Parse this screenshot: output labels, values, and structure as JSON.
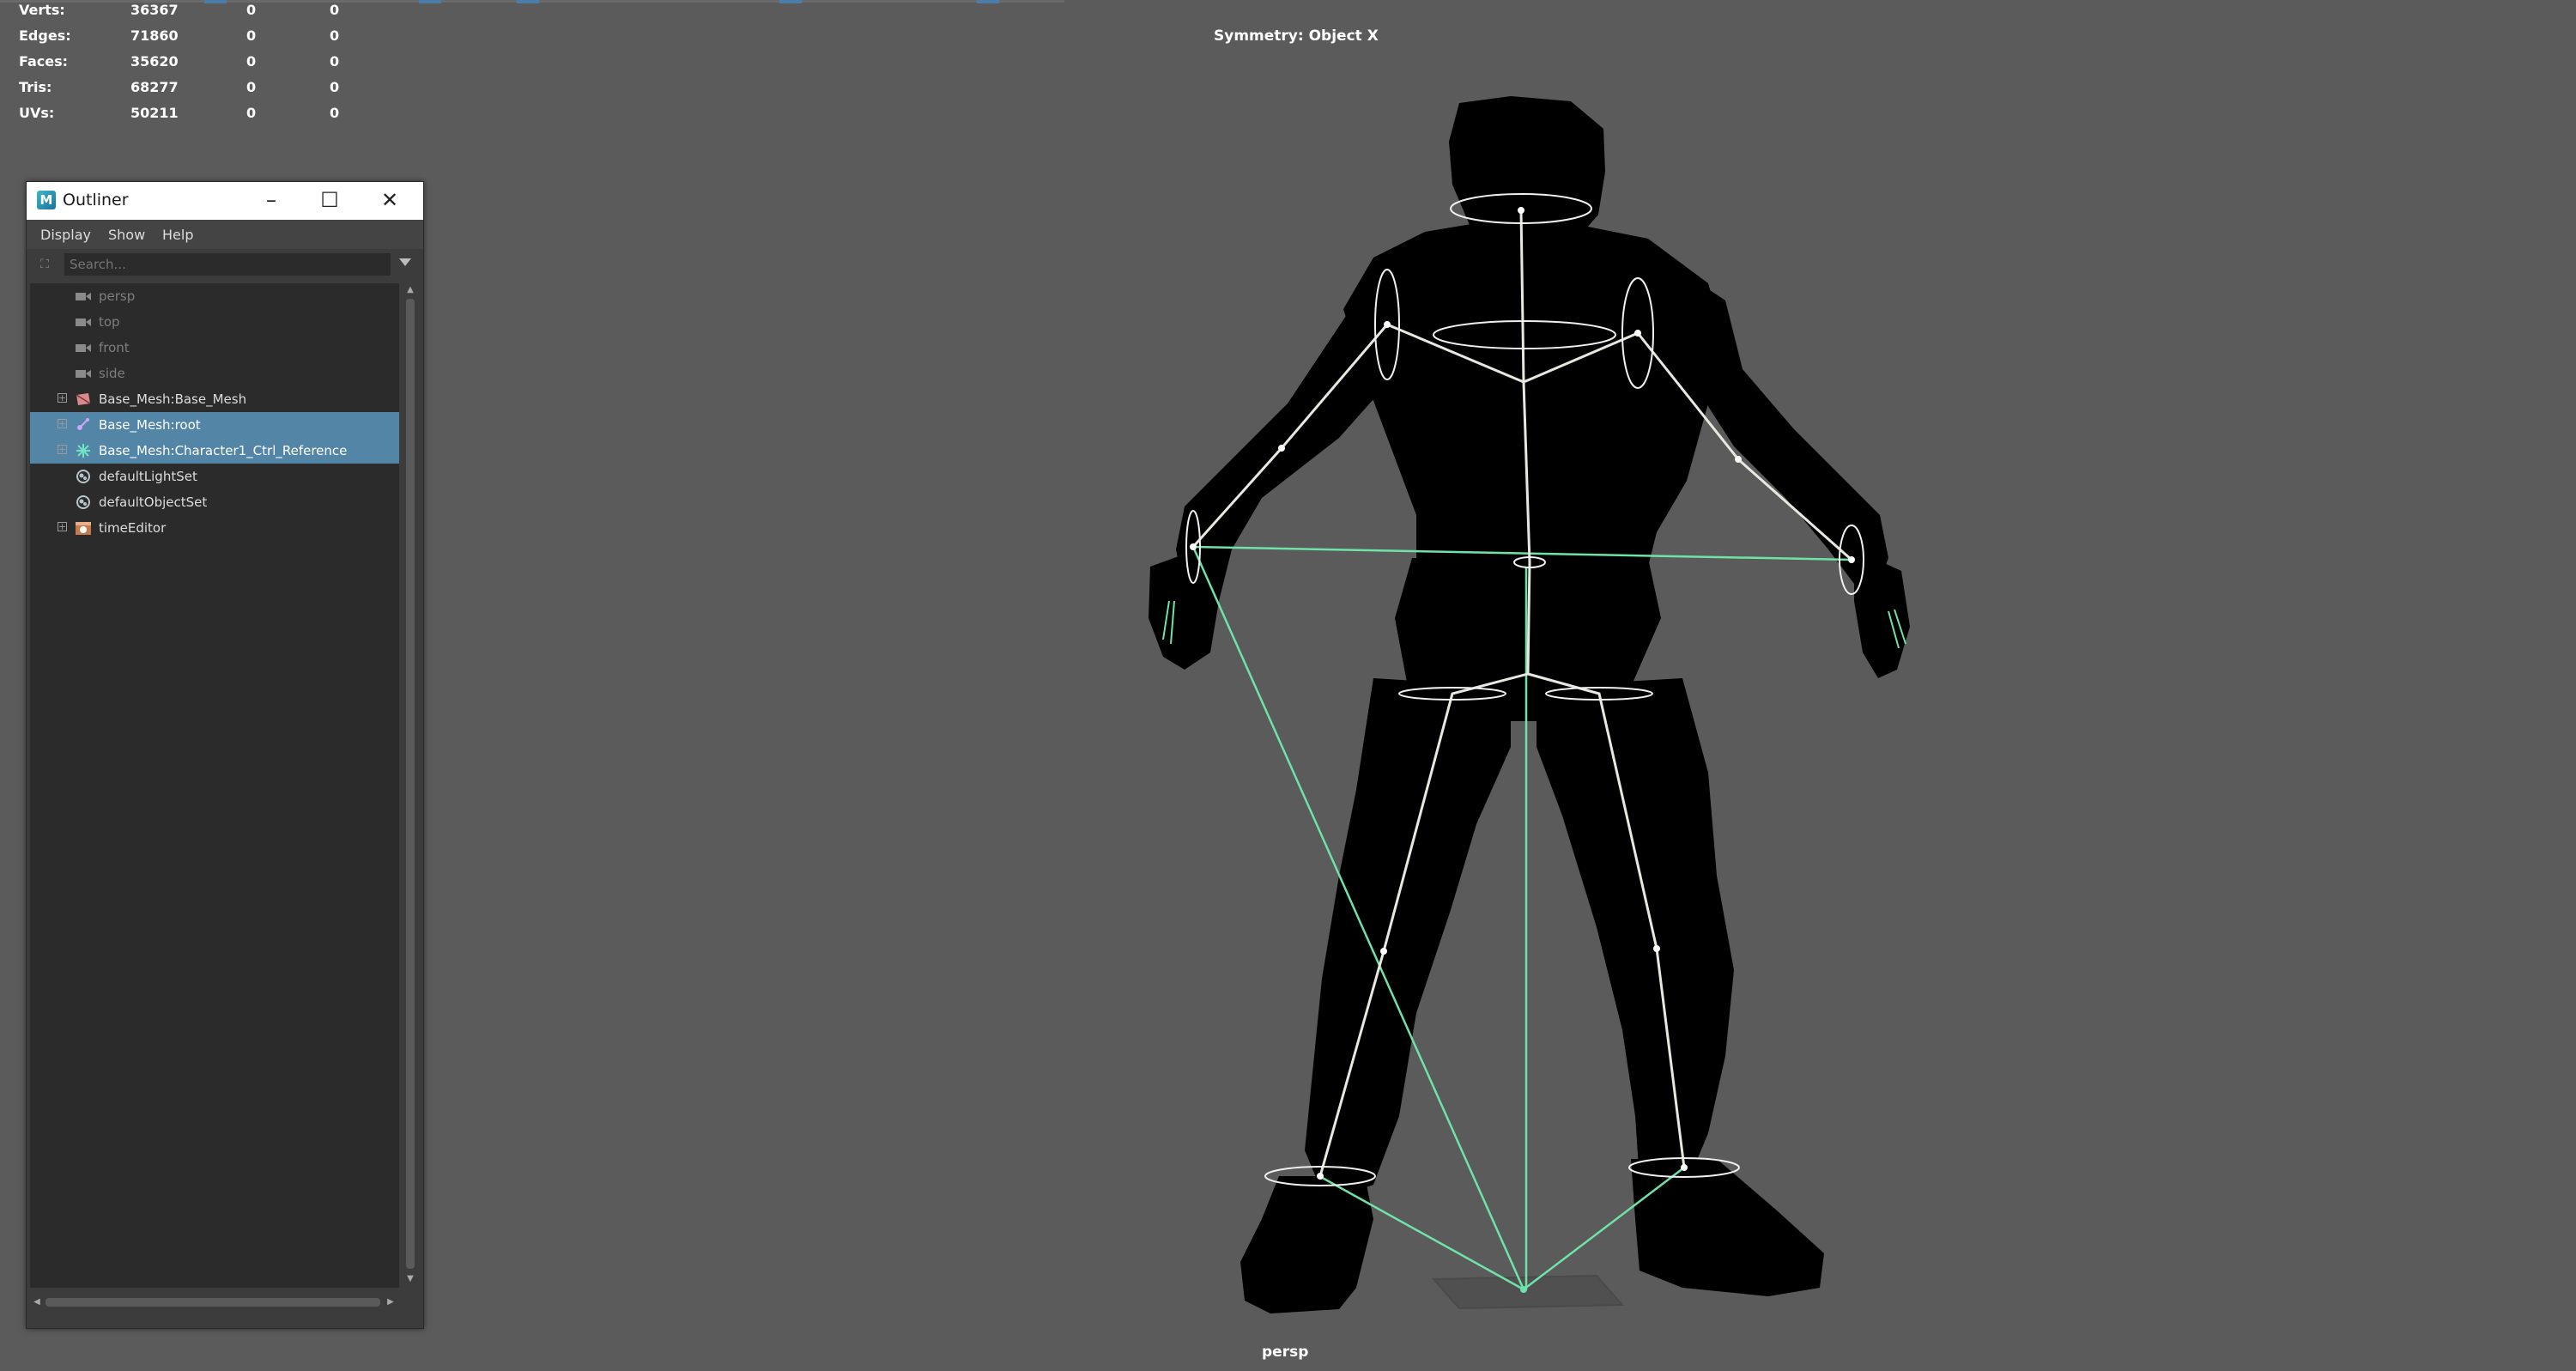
{
  "hud": {
    "rows": [
      {
        "label": "Verts:",
        "v1": "36367",
        "v2": "0",
        "v3": "0"
      },
      {
        "label": "Edges:",
        "v1": "71860",
        "v2": "0",
        "v3": "0"
      },
      {
        "label": "Faces:",
        "v1": "35620",
        "v2": "0",
        "v3": "0"
      },
      {
        "label": "Tris:",
        "v1": "68277",
        "v2": "0",
        "v3": "0"
      },
      {
        "label": "UVs:",
        "v1": "50211",
        "v2": "0",
        "v3": "0"
      }
    ],
    "symmetry": "Symmetry: Object X",
    "camera": "persp"
  },
  "outliner": {
    "app_icon": "M",
    "title": "Outliner",
    "menu": [
      "Display",
      "Show",
      "Help"
    ],
    "search_placeholder": "Search...",
    "items": [
      {
        "label": "persp",
        "icon": "camera-icon",
        "dim": true,
        "expander": false,
        "selected": false
      },
      {
        "label": "top",
        "icon": "camera-icon",
        "dim": true,
        "expander": false,
        "selected": false
      },
      {
        "label": "front",
        "icon": "camera-icon",
        "dim": true,
        "expander": false,
        "selected": false
      },
      {
        "label": "side",
        "icon": "camera-icon",
        "dim": true,
        "expander": false,
        "selected": false
      },
      {
        "label": "Base_Mesh:Base_Mesh",
        "icon": "mesh-transform-icon",
        "dim": false,
        "expander": true,
        "selected": false
      },
      {
        "label": "Base_Mesh:root",
        "icon": "joint-icon",
        "dim": false,
        "expander": true,
        "selected": true
      },
      {
        "label": "Base_Mesh:Character1_Ctrl_Reference",
        "icon": "hik-control-icon",
        "dim": false,
        "expander": true,
        "selected": true
      },
      {
        "label": "defaultLightSet",
        "icon": "set-icon",
        "dim": false,
        "expander": false,
        "selected": false
      },
      {
        "label": "defaultObjectSet",
        "icon": "set-icon",
        "dim": false,
        "expander": false,
        "selected": false
      },
      {
        "label": "timeEditor",
        "icon": "time-editor-icon",
        "dim": false,
        "expander": true,
        "selected": false
      }
    ]
  },
  "colors": {
    "viewport": "#5b5b5b",
    "selection": "#5285a6",
    "skeleton_control": "#6fe3a7",
    "silhouette": "#000000"
  }
}
